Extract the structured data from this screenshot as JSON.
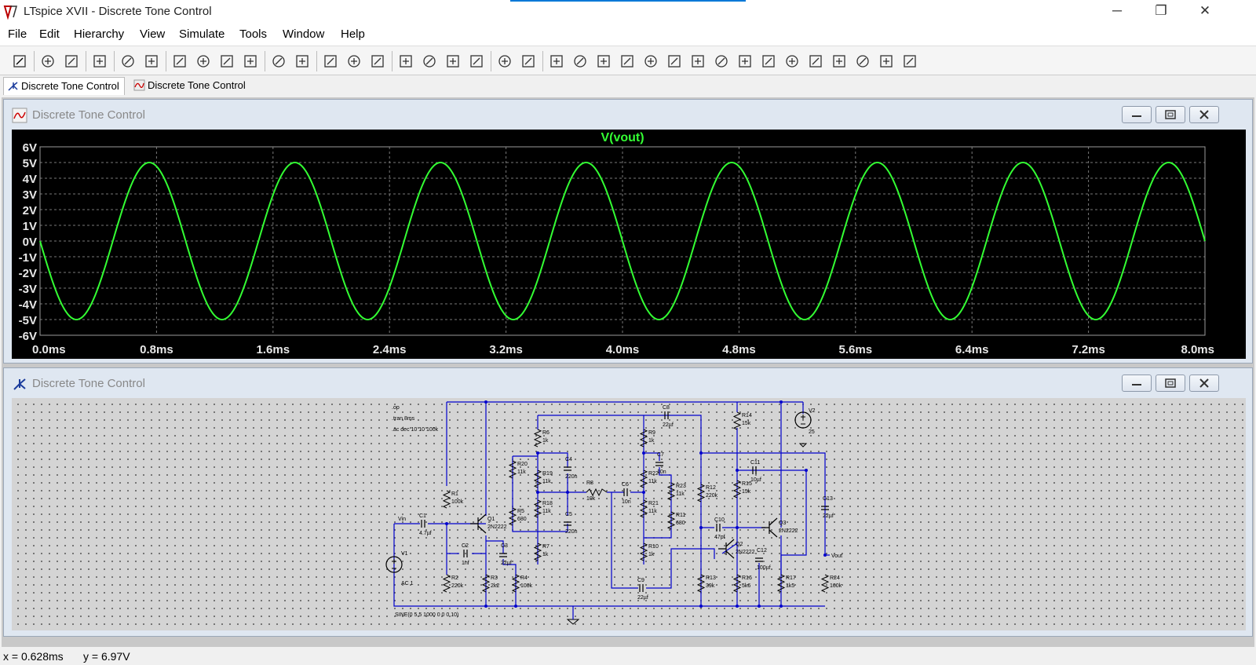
{
  "window": {
    "title": "LTspice XVII - Discrete Tone Control"
  },
  "menu": [
    "File",
    "Edit",
    "Hierarchy",
    "View",
    "Simulate",
    "Tools",
    "Window",
    "Help"
  ],
  "toolbar_icons": [
    "run-icon",
    "open-icon",
    "save-icon",
    "control-panel-icon",
    "run-sim-icon",
    "pan-icon",
    "zoom-in-icon",
    "zoom-rect-icon",
    "zoom-out-icon",
    "zoom-fit-icon",
    "autorange-icon",
    "grid-icon",
    "tile-horizontal-icon",
    "tile-vertical-icon",
    "cascade-icon",
    "cut-icon",
    "copy-icon",
    "paste-icon",
    "find-icon",
    "print-icon",
    "print-preview-icon",
    "draw-wire-icon",
    "ground-icon",
    "label-net-icon",
    "resistor-icon",
    "capacitor-icon",
    "inductor-icon",
    "diode-icon",
    "component-icon",
    "move-icon",
    "drag-icon",
    "undo-icon",
    "redo-icon",
    "rotate-icon",
    "mirror-icon",
    "text-icon",
    "spice-directive-icon"
  ],
  "tabs": [
    {
      "label": "Discrete Tone Control",
      "active": true,
      "kind": "schematic"
    },
    {
      "label": "Discrete Tone Control",
      "active": false,
      "kind": "waveform"
    }
  ],
  "plot_window": {
    "title": "Discrete Tone Control"
  },
  "schematic_window": {
    "title": "Discrete Tone Control"
  },
  "chart_data": {
    "type": "line",
    "title": "V(vout)",
    "xlabel": "",
    "ylabel": "",
    "xlim": [
      0,
      8
    ],
    "ylim": [
      -6,
      6
    ],
    "x_ticks": [
      "0.0ms",
      "0.8ms",
      "1.6ms",
      "2.4ms",
      "3.2ms",
      "4.0ms",
      "4.8ms",
      "5.6ms",
      "6.4ms",
      "7.2ms",
      "8.0ms"
    ],
    "y_ticks": [
      "6V",
      "5V",
      "4V",
      "3V",
      "2V",
      "1V",
      "0V",
      "-1V",
      "-2V",
      "-3V",
      "-4V",
      "-5V",
      "-6V"
    ],
    "series": [
      {
        "name": "V(vout)",
        "color": "#33ff33",
        "amplitude_V": 5,
        "frequency_Hz": 1000,
        "phase_deg": 180
      }
    ],
    "grid": true
  },
  "schematic": {
    "directives": [
      ".op",
      ".tran 8ms",
      ".ac dec 10 10 100k"
    ],
    "source_text": "SINE(0 5.5 1000 0 0 0 10)",
    "parts": [
      {
        "ref": "V1",
        "value": "AC 1"
      },
      {
        "ref": "V2",
        "value": "25"
      },
      {
        "ref": "C1",
        "value": "4.7µf"
      },
      {
        "ref": "C2",
        "value": "1nf"
      },
      {
        "ref": "C3",
        "value": "22µf"
      },
      {
        "ref": "C4",
        "value": "220n"
      },
      {
        "ref": "C5",
        "value": "220n"
      },
      {
        "ref": "C6",
        "value": "10n"
      },
      {
        "ref": "C7",
        "value": "10n"
      },
      {
        "ref": "C8",
        "value": "22µf"
      },
      {
        "ref": "C9",
        "value": "22µf"
      },
      {
        "ref": "C10",
        "value": "47pf"
      },
      {
        "ref": "C11",
        "value": "10µf"
      },
      {
        "ref": "C12",
        "value": "100µf"
      },
      {
        "ref": "C13",
        "value": "22µf"
      },
      {
        "ref": "R1",
        "value": "100k"
      },
      {
        "ref": "R2",
        "value": "220k"
      },
      {
        "ref": "R3",
        "value": "2k2"
      },
      {
        "ref": "R4",
        "value": "100k"
      },
      {
        "ref": "R5",
        "value": "680"
      },
      {
        "ref": "R6",
        "value": "1k"
      },
      {
        "ref": "R7",
        "value": "1k"
      },
      {
        "ref": "R8",
        "value": "10k"
      },
      {
        "ref": "R9",
        "value": "1k"
      },
      {
        "ref": "R10",
        "value": "1k"
      },
      {
        "ref": "R11",
        "value": "680"
      },
      {
        "ref": "R12",
        "value": "220k"
      },
      {
        "ref": "R13",
        "value": "39k"
      },
      {
        "ref": "R14",
        "value": "15k"
      },
      {
        "ref": "R15",
        "value": "15k"
      },
      {
        "ref": "R16",
        "value": "5k6"
      },
      {
        "ref": "R17",
        "value": "1k5"
      },
      {
        "ref": "R18",
        "value": "11k"
      },
      {
        "ref": "R19",
        "value": "11k"
      },
      {
        "ref": "R20",
        "value": "11k"
      },
      {
        "ref": "R21",
        "value": "11k"
      },
      {
        "ref": "R22",
        "value": "11k"
      },
      {
        "ref": "R23",
        "value": "11k"
      },
      {
        "ref": "R24",
        "value": "100k"
      },
      {
        "ref": "Q1",
        "value": "2N2222"
      },
      {
        "ref": "Q2",
        "value": "2N2222"
      },
      {
        "ref": "Q3",
        "value": "2N2222"
      }
    ],
    "nets": [
      "Vin",
      "Vout"
    ]
  },
  "status": {
    "x": "x = 0.628ms",
    "y": "y = 6.97V"
  },
  "colors": {
    "trace": "#33ff33",
    "wire": "#0000cc",
    "component": "#000000"
  }
}
